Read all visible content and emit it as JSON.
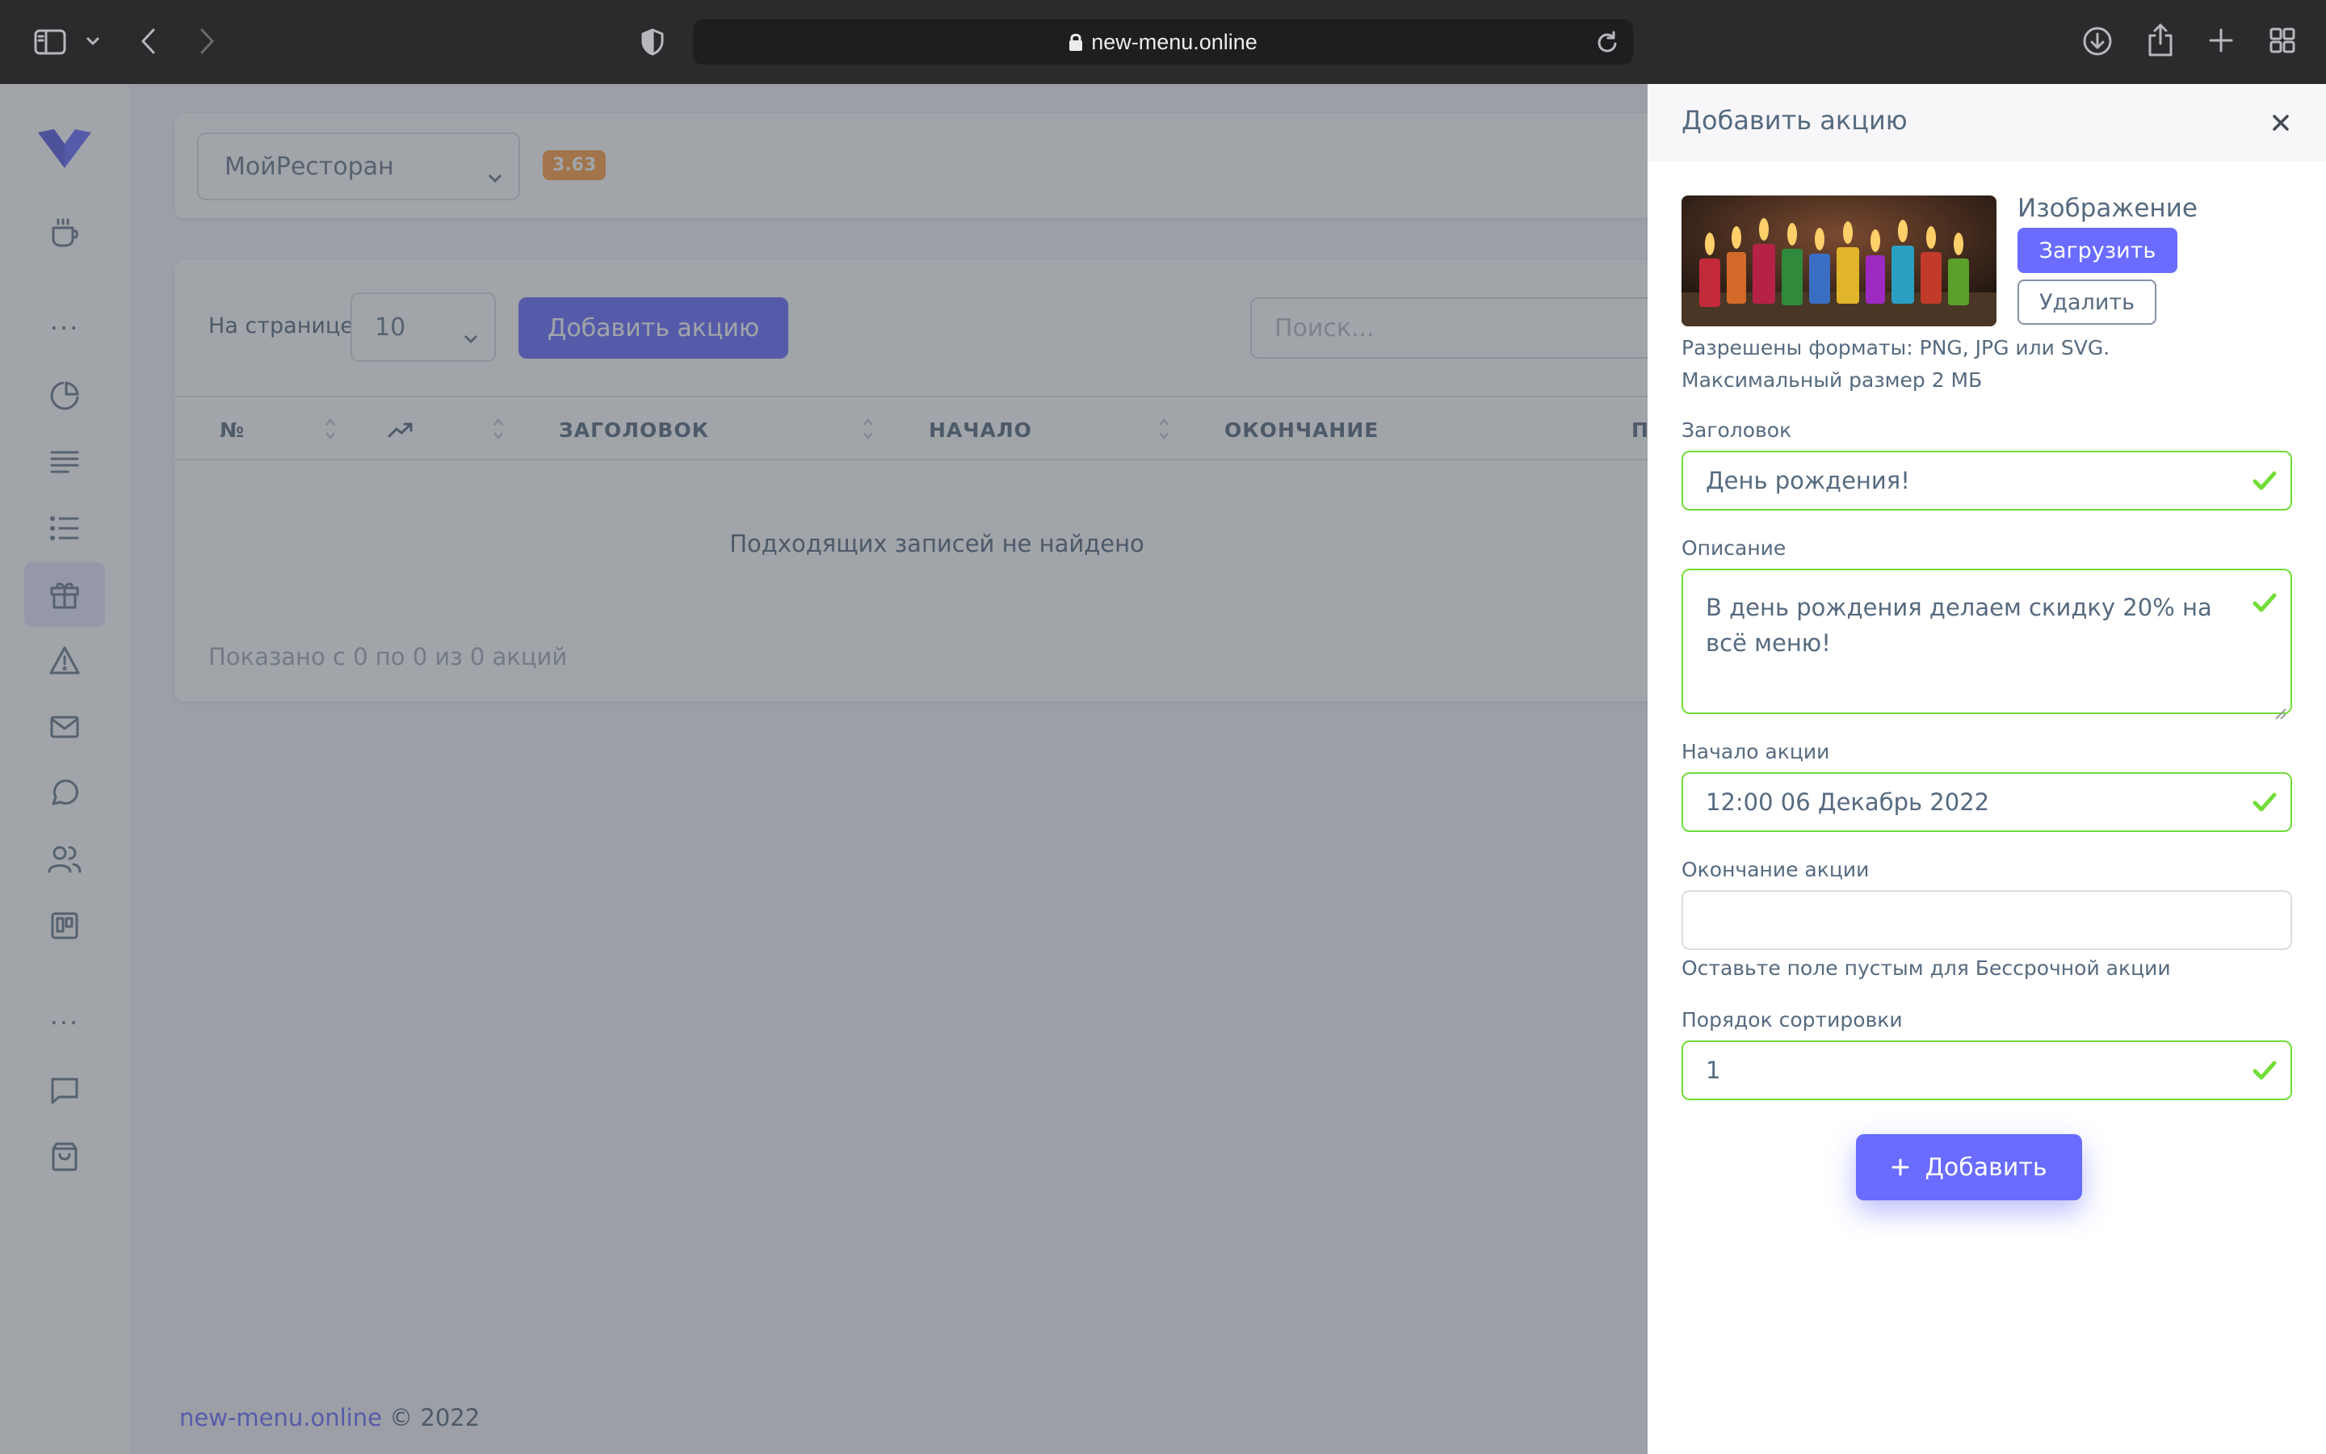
{
  "browser": {
    "url": "new-menu.online",
    "icons": [
      "sidebar-toggle-icon",
      "chevron-down-icon",
      "back-icon",
      "forward-icon",
      "shield-icon",
      "lock-icon",
      "reload-icon",
      "download-icon",
      "share-icon",
      "new-tab-icon",
      "tab-overview-icon"
    ]
  },
  "sidebar": {
    "icons": [
      "logo-icon",
      "cup-icon",
      "more-icon",
      "pie-chart-icon",
      "text-lines-icon",
      "list-icon",
      "gift-icon",
      "alert-icon",
      "mail-icon",
      "chat-icon",
      "users-icon",
      "kanban-icon",
      "more-icon",
      "message-square-icon",
      "bag-icon"
    ],
    "active": "gift-icon",
    "more_label": "..."
  },
  "header": {
    "restaurant_select": "МойРесторан",
    "version_badge": "3.63"
  },
  "list": {
    "per_page_label": "На странице",
    "per_page_value": "10",
    "add_button": "Добавить акцию",
    "search_placeholder": "Поиск...",
    "columns": [
      "№",
      "",
      "ЗАГОЛОВОК",
      "НАЧАЛО",
      "ОКОНЧАНИЕ",
      "П"
    ],
    "empty_text": "Подходящих записей не найдено",
    "info_text": "Показано с 0 по 0 из 0 акций"
  },
  "footer": {
    "link": "new-menu.online",
    "copyright": "© 2022"
  },
  "panel": {
    "title": "Добавить акцию",
    "image_label": "Изображение",
    "upload_button": "Загрузить",
    "delete_button": "Удалить",
    "formats_hint": "Разрешены форматы: PNG, JPG или SVG.",
    "size_hint": "Максимальный размер 2 МБ",
    "title_label": "Заголовок",
    "title_value": "День рождения!",
    "description_label": "Описание",
    "description_value": "В день рождения делаем скидку 20% на всё меню!",
    "start_label": "Начало акции",
    "start_value": "12:00 06 Декабрь 2022",
    "end_label": "Окончание акции",
    "end_value": "",
    "end_hint": "Оставьте поле пустым для Бессрочной акции",
    "sort_label": "Порядок сортировки",
    "sort_value": "1",
    "submit_button": "Добавить"
  },
  "colors": {
    "primary": "#696cff",
    "valid": "#71dd37",
    "badge": "#ff9f43",
    "chrome": "#2b2b2d"
  }
}
